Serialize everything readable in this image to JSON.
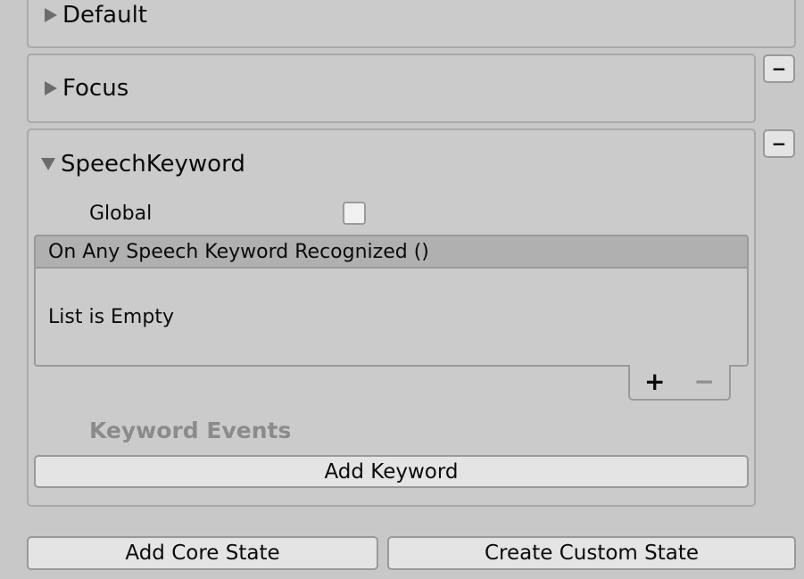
{
  "states": {
    "default": {
      "label": "Default"
    },
    "focus": {
      "label": "Focus",
      "remove_label": "−"
    },
    "speech_keyword": {
      "label": "SpeechKeyword",
      "remove_label": "−",
      "global_label": "Global",
      "global_checked": false,
      "event_header": "On Any Speech Keyword Recognized ()",
      "list_empty_text": "List is Empty",
      "list_add_label": "+",
      "list_remove_label": "−",
      "keyword_events_label": "Keyword Events",
      "add_keyword_label": "Add Keyword"
    }
  },
  "footer": {
    "add_core_state_label": "Add Core State",
    "create_custom_state_label": "Create Custom State"
  }
}
